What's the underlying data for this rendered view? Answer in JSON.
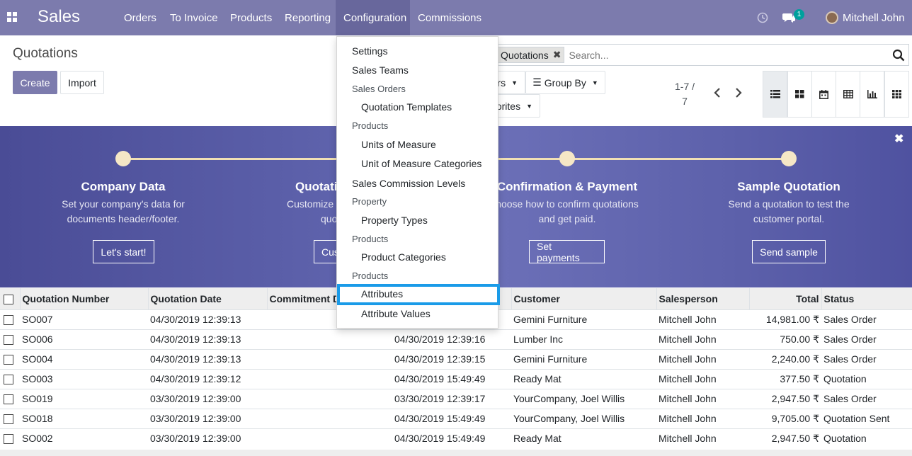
{
  "topbar": {
    "brand": "Sales",
    "nav": [
      "Orders",
      "To Invoice",
      "Products",
      "Reporting",
      "Configuration",
      "Commissions"
    ],
    "active_nav": "Configuration",
    "messages_count": "1",
    "user_name": "Mitchell John"
  },
  "control": {
    "title": "Quotations",
    "create_label": "Create",
    "import_label": "Import",
    "facet_label": "Quotations",
    "search_placeholder": "Search...",
    "filters_label": "rs",
    "group_by_label": "Group By",
    "favorites_label": "orites",
    "pager_range": "1-7 /",
    "pager_total": "7"
  },
  "onboarding": {
    "steps": [
      {
        "title": "Company Data",
        "desc1": "Set your company's data for",
        "desc2": "documents header/footer.",
        "button": "Let's start!"
      },
      {
        "title": "Quotati",
        "desc1": "Customize",
        "desc2": "quo",
        "button": "Cus"
      },
      {
        "title": "Confirmation & Payment",
        "desc1": "hoose how to confirm quotations",
        "desc2": "and get paid.",
        "button": "Set payments"
      },
      {
        "title": "Sample Quotation",
        "desc1": "Send a quotation to test the",
        "desc2": "customer portal.",
        "button": "Send sample"
      }
    ]
  },
  "config_menu": {
    "settings": "Settings",
    "sales_teams": "Sales Teams",
    "sec_sales_orders": "Sales Orders",
    "quotation_templates": "Quotation Templates",
    "sec_products_1": "Products",
    "uom": "Units of Measure",
    "uom_categories": "Unit of Measure Categories",
    "commission_levels": "Sales Commission Levels",
    "sec_property": "Property",
    "property_types": "Property Types",
    "sec_products_2": "Products",
    "product_categories": "Product Categories",
    "sec_products_3": "Products",
    "attributes": "Attributes",
    "attribute_values": "Attribute Values"
  },
  "table": {
    "headers": [
      "Quotation Number",
      "Quotation Date",
      "Commitment D",
      "Customer",
      "Salesperson",
      "Total",
      "Status"
    ],
    "rows": [
      [
        "SO007",
        "04/30/2019 12:39:13",
        "",
        "Gemini Furniture",
        "Mitchell John",
        "14,981.00 ₹",
        "Sales Order"
      ],
      [
        "SO006",
        "04/30/2019 12:39:13",
        "04/30/2019 12:39:16",
        "Lumber Inc",
        "Mitchell John",
        "750.00 ₹",
        "Sales Order"
      ],
      [
        "SO004",
        "04/30/2019 12:39:13",
        "04/30/2019 12:39:15",
        "Gemini Furniture",
        "Mitchell John",
        "2,240.00 ₹",
        "Sales Order"
      ],
      [
        "SO003",
        "04/30/2019 12:39:12",
        "04/30/2019 15:49:49",
        "Ready Mat",
        "Mitchell John",
        "377.50 ₹",
        "Quotation"
      ],
      [
        "SO019",
        "03/30/2019 12:39:00",
        "03/30/2019 12:39:17",
        "YourCompany, Joel Willis",
        "Mitchell John",
        "2,947.50 ₹",
        "Sales Order"
      ],
      [
        "SO018",
        "03/30/2019 12:39:00",
        "04/30/2019 15:49:49",
        "YourCompany, Joel Willis",
        "Mitchell John",
        "9,705.00 ₹",
        "Quotation Sent"
      ],
      [
        "SO002",
        "03/30/2019 12:39:00",
        "04/30/2019 15:49:49",
        "Ready Mat",
        "Mitchell John",
        "2,947.50 ₹",
        "Quotation"
      ]
    ]
  },
  "colors": {
    "brand": "#7c7bad",
    "highlight": "#1a9be8"
  }
}
